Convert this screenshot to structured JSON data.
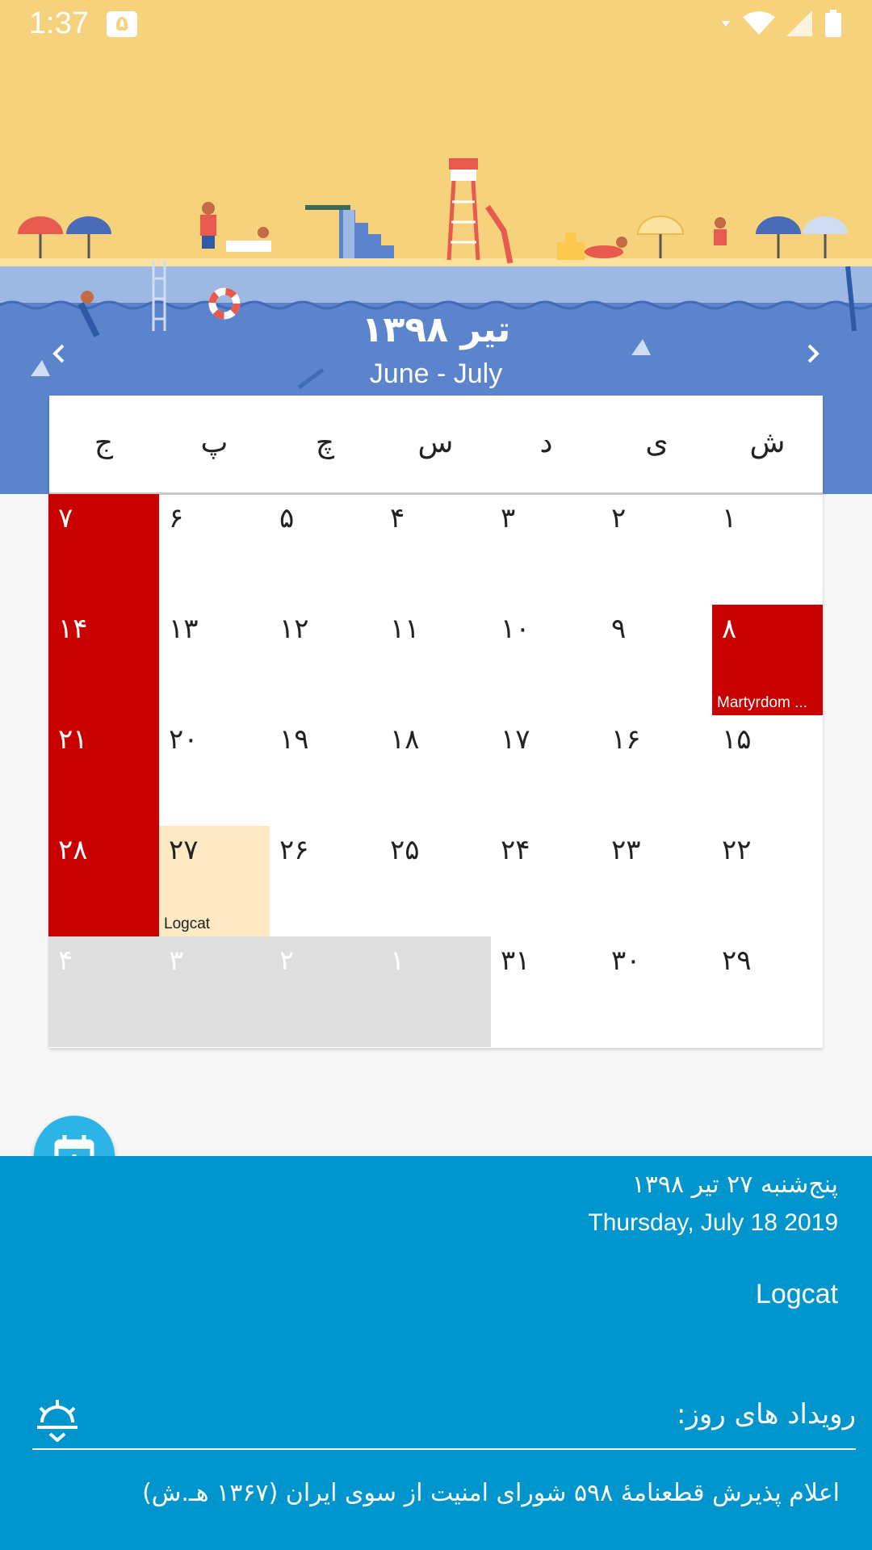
{
  "status_bar": {
    "time": "1:37",
    "notification": "۵"
  },
  "header": {
    "month_title": "تیر ۱۳۹۸",
    "month_subtitle": "June - July",
    "prev_icon": "chevron-left-icon",
    "next_icon": "chevron-right-icon"
  },
  "calendar": {
    "weekdays": [
      "ش",
      "ی",
      "د",
      "س",
      "چ",
      "پ",
      "ج"
    ],
    "weeks": [
      [
        {
          "n": "۱"
        },
        {
          "n": "۲"
        },
        {
          "n": "۳"
        },
        {
          "n": "۴"
        },
        {
          "n": "۵"
        },
        {
          "n": "۶"
        },
        {
          "n": "۷",
          "holiday": true
        }
      ],
      [
        {
          "n": "۸",
          "holiday": true,
          "event": "Martyrdom ..."
        },
        {
          "n": "۹"
        },
        {
          "n": "۱۰"
        },
        {
          "n": "۱۱"
        },
        {
          "n": "۱۲"
        },
        {
          "n": "۱۳"
        },
        {
          "n": "۱۴",
          "holiday": true
        }
      ],
      [
        {
          "n": "۱۵"
        },
        {
          "n": "۱۶"
        },
        {
          "n": "۱۷"
        },
        {
          "n": "۱۸"
        },
        {
          "n": "۱۹"
        },
        {
          "n": "۲۰"
        },
        {
          "n": "۲۱",
          "holiday": true
        }
      ],
      [
        {
          "n": "۲۲"
        },
        {
          "n": "۲۳"
        },
        {
          "n": "۲۴"
        },
        {
          "n": "۲۵"
        },
        {
          "n": "۲۶"
        },
        {
          "n": "۲۷",
          "today": true,
          "event": "Logcat"
        },
        {
          "n": "۲۸",
          "holiday": true
        }
      ],
      [
        {
          "n": "۲۹"
        },
        {
          "n": "۳۰"
        },
        {
          "n": "۳۱"
        },
        {
          "n": "۱",
          "other": true
        },
        {
          "n": "۲",
          "other": true
        },
        {
          "n": "۳",
          "other": true
        },
        {
          "n": "۴",
          "other": true
        }
      ]
    ]
  },
  "fab": {
    "icon": "calendar-add-icon"
  },
  "day_info": {
    "persian_date": "پنج‌شنبه  ۲۷  تیر  ۱۳۹۸",
    "gregorian_date": "Thursday,  July  18  2019",
    "event_name": "Logcat",
    "events_header": "رویداد های روز:",
    "events_icon": "sunrise-icon",
    "occasion": "اعلام پذیرش قطعنامهٔ ۵۹۸ شورای امنیت از سوی ایران (۱۳۶۷ هـ.ش)"
  },
  "colors": {
    "sky": "#f6d27c",
    "water_top": "#9eb8e4",
    "water": "#5b84cc",
    "holiday": "#c90000",
    "today": "#fde9c4",
    "other_month": "#dedede",
    "sheet": "#0095cc",
    "fab": "#2db4e6"
  }
}
